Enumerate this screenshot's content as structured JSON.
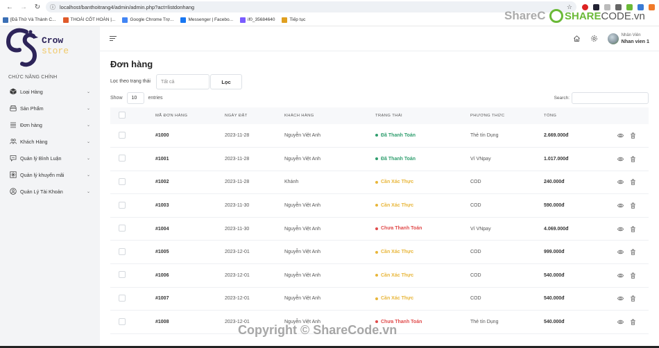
{
  "browser": {
    "url": "localhost/banthoitrang4/admin/admin.php?act=listdonhang",
    "bookmarks": [
      {
        "label": "[Đã Thử Và Thành C...",
        "color": "#3a6fb5"
      },
      {
        "label": "THOÁI CỐT HOÀN |...",
        "color": "#e05a2a"
      },
      {
        "label": "Google Chrome Trợ...",
        "color": "#4285f4"
      },
      {
        "label": "Messenger | Facebo...",
        "color": "#1877f2"
      },
      {
        "label": "if0_35684640",
        "color": "#7a5cff"
      },
      {
        "label": "Tiếp tục",
        "color": "#e0a020"
      }
    ]
  },
  "watermark": {
    "top_text": "ShareC",
    "logo_text": "SHARE",
    "logo_text2": "CODE.vn",
    "bottom_text": "Copyright © ShareCode.vn"
  },
  "sidebar": {
    "logo_line1": "Crow",
    "logo_line2": "store",
    "section_title": "CHỨC NĂNG CHÍNH",
    "items": [
      {
        "label": "Loại Hàng",
        "icon": "box-icon"
      },
      {
        "label": "Sản Phẩm",
        "icon": "product-icon"
      },
      {
        "label": "Đơn hàng",
        "icon": "list-icon"
      },
      {
        "label": "Khách Hàng",
        "icon": "users-icon"
      },
      {
        "label": "Quản lý Bình Luận",
        "icon": "comment-icon"
      },
      {
        "label": "Quản lý khuyến mãi",
        "icon": "promo-icon"
      },
      {
        "label": "Quản Lý Tài Khoản",
        "icon": "account-icon"
      }
    ]
  },
  "header": {
    "user_role": "Nhân Viên",
    "user_name": "Nhan vien 1"
  },
  "main": {
    "title": "Đơn hàng",
    "filter_label": "Lọc theo trạng thái",
    "filter_placeholder": "Tất cả",
    "filter_button": "Lọc",
    "show_label": "Show",
    "page_length": "10",
    "entries_label": "entries",
    "search_label": "Search:",
    "search_value": "",
    "columns": [
      "MÃ ĐƠN HÀNG",
      "NGÀY ĐẶT",
      "KHÁCH HÀNG",
      "TRẠNG THÁI",
      "PHƯƠNG THỨC",
      "TỔNG"
    ],
    "status_colors": {
      "Đã Thanh Toán": "#2f9e6e",
      "Cần Xác Thực": "#e8b63a",
      "Chưa Thanh Toán": "#e04b4b"
    },
    "rows": [
      {
        "id": "#1000",
        "date": "2023-11-28",
        "customer": "Nguyễn Việt Anh",
        "status": "Đã Thanh Toán",
        "method": "Thẻ tín Dụng",
        "total": "2.669.000đ"
      },
      {
        "id": "#1001",
        "date": "2023-11-28",
        "customer": "Nguyễn Việt Anh",
        "status": "Đã Thanh Toán",
        "method": "Ví VNpay",
        "total": "1.017.000đ"
      },
      {
        "id": "#1002",
        "date": "2023-11-28",
        "customer": "Khánh",
        "status": "Cần Xác Thực",
        "method": "COD",
        "total": "240.000đ"
      },
      {
        "id": "#1003",
        "date": "2023-11-30",
        "customer": "Nguyễn Việt Anh",
        "status": "Cần Xác Thực",
        "method": "COD",
        "total": "590.000đ"
      },
      {
        "id": "#1004",
        "date": "2023-11-30",
        "customer": "Nguyễn Việt Anh",
        "status": "Chưa Thanh Toán",
        "method": "Ví VNpay",
        "total": "4.069.000đ"
      },
      {
        "id": "#1005",
        "date": "2023-12-01",
        "customer": "Nguyễn Việt Anh",
        "status": "Cần Xác Thực",
        "method": "COD",
        "total": "999.000đ"
      },
      {
        "id": "#1006",
        "date": "2023-12-01",
        "customer": "Nguyễn Việt Anh",
        "status": "Cần Xác Thực",
        "method": "COD",
        "total": "540.000đ"
      },
      {
        "id": "#1007",
        "date": "2023-12-01",
        "customer": "Nguyễn Việt Anh",
        "status": "Cần Xác Thực",
        "method": "COD",
        "total": "540.000đ"
      },
      {
        "id": "#1008",
        "date": "2023-12-01",
        "customer": "Nguyễn Việt Anh",
        "status": "Chưa Thanh Toán",
        "method": "Thẻ tín Dụng",
        "total": "540.000đ"
      }
    ]
  }
}
